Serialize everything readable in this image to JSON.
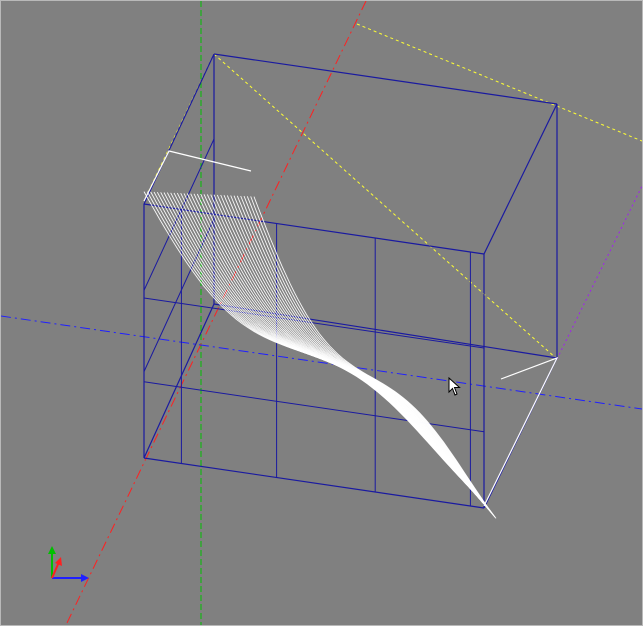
{
  "viewport": {
    "background": "#808080",
    "view": "3d-cad-view"
  },
  "colors": {
    "wireframe": "#1a1aa0",
    "toolpath": "#ffffff",
    "axis_x": "#2020ff",
    "axis_y": "#00c000",
    "axis_z": "#ff2020",
    "bbox_dashed": "#ffff33",
    "plane_dashed": "#a020f0",
    "frame": "#b9b9b9"
  },
  "scene": {
    "toolpath_passes": 34
  },
  "triad": {
    "axes": [
      "x-axis",
      "y-axis",
      "z-axis"
    ]
  },
  "cursor": {
    "icon": "arrow-cursor-icon"
  }
}
